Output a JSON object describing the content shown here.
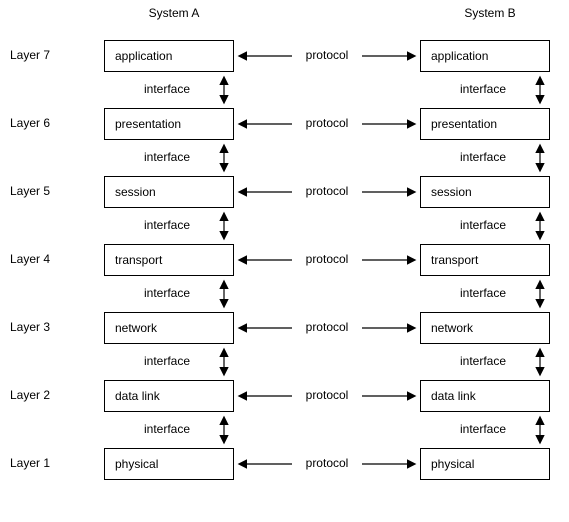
{
  "headers": {
    "systemA": "System A",
    "systemB": "System B"
  },
  "rowLabels": [
    "Layer 7",
    "Layer 6",
    "Layer 5",
    "Layer 4",
    "Layer 3",
    "Layer 2",
    "Layer 1"
  ],
  "boxesA": [
    "application",
    "presentation",
    "session",
    "transport",
    "network",
    "data link",
    "physical"
  ],
  "boxesB": [
    "application",
    "presentation",
    "session",
    "transport",
    "network",
    "data link",
    "physical"
  ],
  "interfaceA": [
    "interface",
    "interface",
    "interface",
    "interface",
    "interface",
    "interface"
  ],
  "interfaceB": [
    "interface",
    "interface",
    "interface",
    "interface",
    "interface",
    "interface"
  ],
  "protocol": [
    "protocol",
    "protocol",
    "protocol",
    "protocol",
    "protocol",
    "protocol",
    "protocol"
  ]
}
